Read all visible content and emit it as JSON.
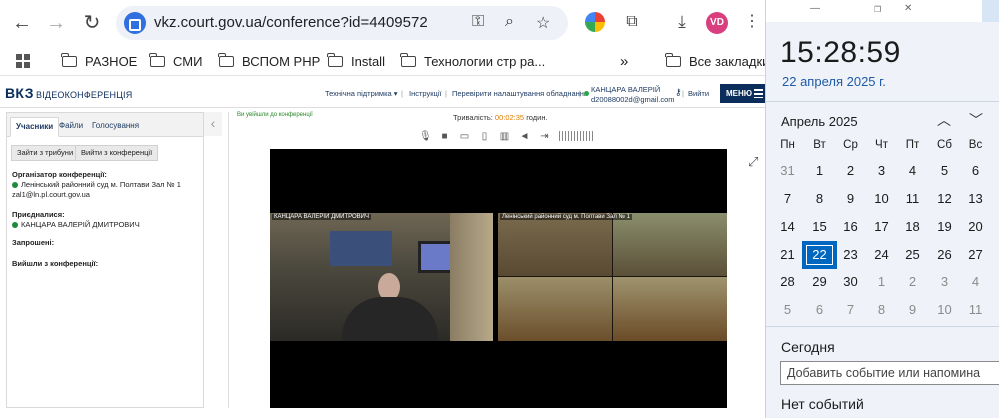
{
  "browser": {
    "url": "vkz.court.gov.ua/conference?id=4409572",
    "profile_initials": "VD",
    "bookmarks": [
      "РАЗНОЕ",
      "СМИ",
      "ВСПОМ РНР",
      "Install",
      "Технологии стр ра...",
      "Все закладки"
    ],
    "overflow": "»"
  },
  "site": {
    "logo": "ВКЗ",
    "logo_sub": "ВІДЕОКОНФЕРЕНЦІЯ",
    "nav": {
      "support": "Технічна підтримка ▾",
      "instructions": "Інструкції",
      "check": "Перевірити налаштування обладнання"
    },
    "user": {
      "name": "КАНЦАРА ВАЛЕРІЙ",
      "email": "d20088002d@gmail.com"
    },
    "logout": "Вийти",
    "menu": "МЕНЮ"
  },
  "left_panel": {
    "tabs": [
      "Учасники",
      "Файли",
      "Голосування"
    ],
    "buttons": {
      "leave_tribune": "Зайти з трибуни",
      "leave_conf": "Вийти з конференції"
    },
    "organizer_title": "Організатор конференції:",
    "organizer_name": "Ленінський районний суд м. Полтави Зал № 1",
    "organizer_email": "zal1@ln.pl.court.gov.ua",
    "joined_title": "Приєдналися:",
    "joined_name": "КАНЦАРА ВАЛЕРІЙ ДМИТРОВИЧ",
    "invited_title": "Запрошені:",
    "left_title": "Вийшли з конференції:"
  },
  "conference": {
    "joined_notice": "Ви увійшли до конференції",
    "duration_label": "Тривалість:",
    "duration_value": "00:02:35",
    "duration_unit": "годин.",
    "tile_left": "КАНЦАРА ВАЛЕРІЙ ДМИТРОВИЧ",
    "tile_right": "Ленінський районний суд м. Полтави Зал № 1"
  },
  "calendar": {
    "time": "15:28:59",
    "date": "22 апреля 2025 г.",
    "month": "Апрель 2025",
    "weekdays": [
      "Пн",
      "Вт",
      "Ср",
      "Чт",
      "Пт",
      "Сб",
      "Вс"
    ],
    "days": [
      [
        "31",
        "1",
        "2",
        "3",
        "4",
        "5",
        "6"
      ],
      [
        "7",
        "8",
        "9",
        "10",
        "11",
        "12",
        "13"
      ],
      [
        "14",
        "15",
        "16",
        "17",
        "18",
        "19",
        "20"
      ],
      [
        "21",
        "22",
        "23",
        "24",
        "25",
        "26",
        "27"
      ],
      [
        "28",
        "29",
        "30",
        "1",
        "2",
        "3",
        "4"
      ],
      [
        "5",
        "6",
        "7",
        "8",
        "9",
        "10",
        "11"
      ]
    ],
    "today_label": "Сегодня",
    "add_event_placeholder": "Добавить событие или напомина",
    "no_events": "Нет событий"
  }
}
